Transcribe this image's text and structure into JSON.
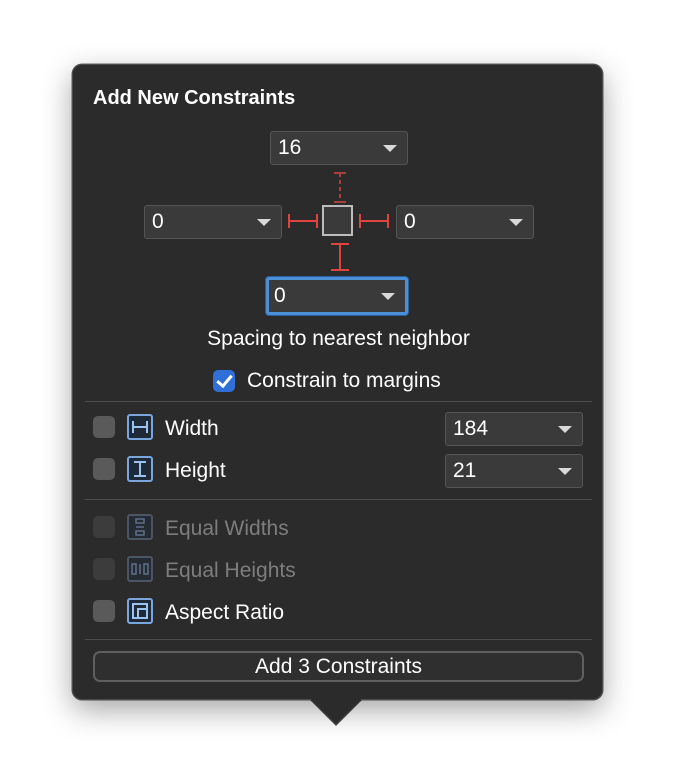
{
  "popover": {
    "title": "Add New Constraints",
    "spacing": {
      "top": "16",
      "left": "0",
      "right": "0",
      "bottom": "0",
      "label": "Spacing to nearest neighbor"
    },
    "constrain_to_margins": {
      "label": "Constrain to margins",
      "checked": true
    },
    "width": {
      "label": "Width",
      "value": "184",
      "checked": false
    },
    "height": {
      "label": "Height",
      "value": "21",
      "checked": false
    },
    "equal_widths": {
      "label": "Equal Widths",
      "enabled": false
    },
    "equal_heights": {
      "label": "Equal Heights",
      "enabled": false
    },
    "aspect_ratio": {
      "label": "Aspect Ratio",
      "checked": false
    },
    "add_button_label": "Add 3 Constraints"
  },
  "colors": {
    "background": "#2b2b2b",
    "accent": "#2f6fd7",
    "constraint_red": "#e0443e",
    "icon_blue": "#7aa6de"
  }
}
